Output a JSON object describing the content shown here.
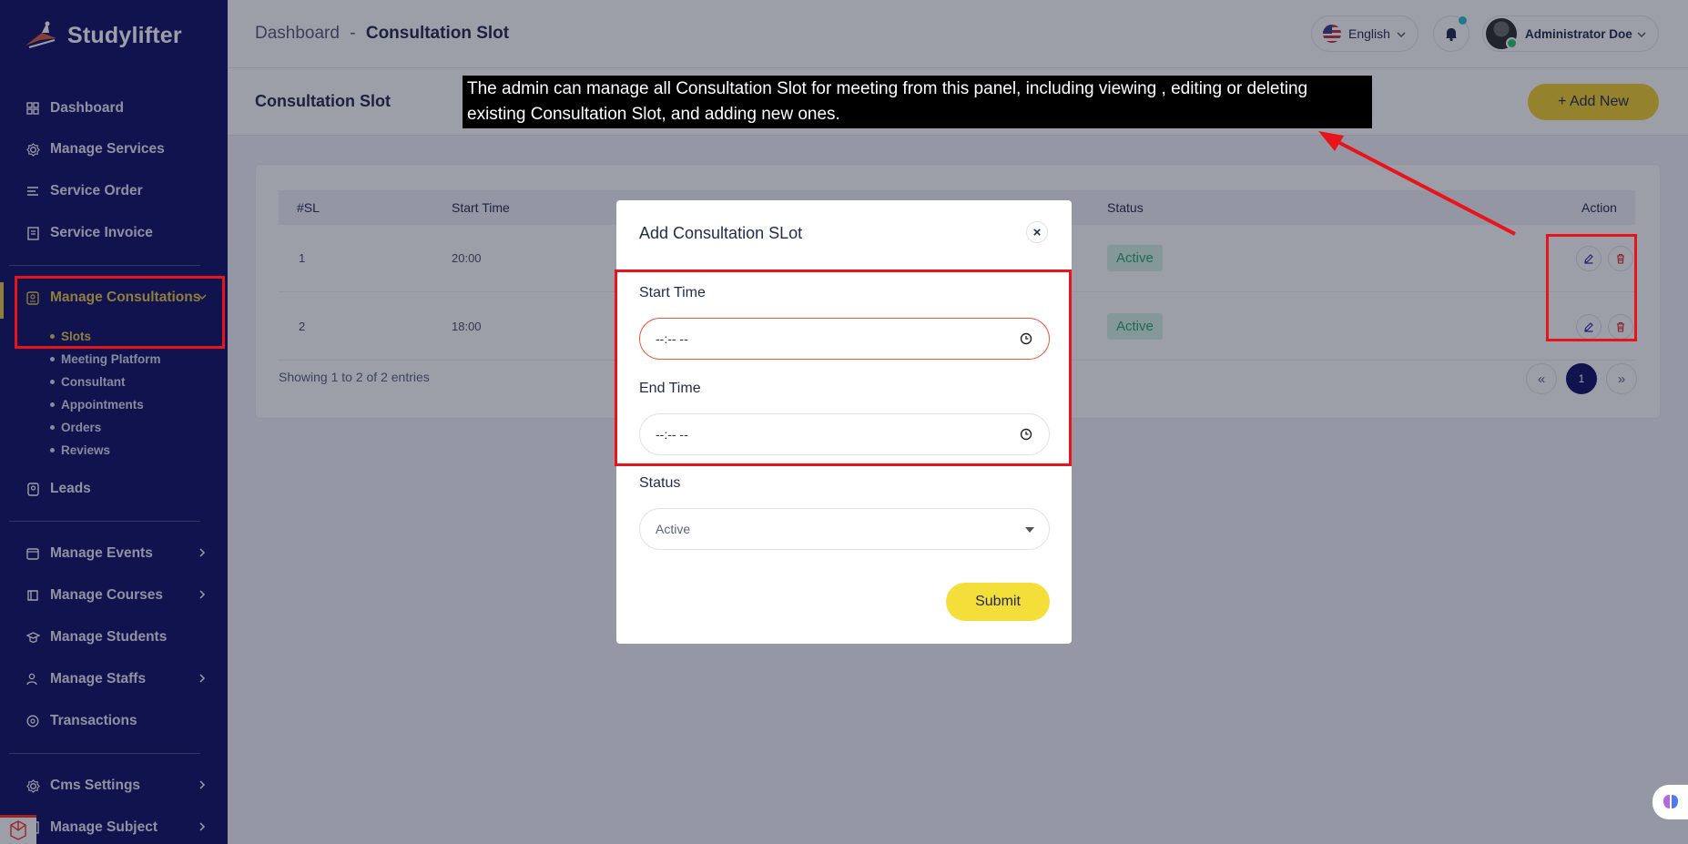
{
  "app": {
    "name": "Studylifter"
  },
  "sidebar": {
    "items": [
      {
        "label": "Dashboard",
        "icon": "grid-icon"
      },
      {
        "label": "Manage Services",
        "icon": "settings-icon"
      },
      {
        "label": "Service Order",
        "icon": "list-icon"
      },
      {
        "label": "Service Invoice",
        "icon": "invoice-icon"
      },
      {
        "label": "Manage Consultations",
        "icon": "consult-icon"
      },
      {
        "label": "Leads",
        "icon": "leads-icon"
      },
      {
        "label": "Manage Events",
        "icon": "calendar-icon"
      },
      {
        "label": "Manage Courses",
        "icon": "courses-icon"
      },
      {
        "label": "Manage Students",
        "icon": "students-icon"
      },
      {
        "label": "Manage Staffs",
        "icon": "staff-icon"
      },
      {
        "label": "Transactions",
        "icon": "transactions-icon"
      },
      {
        "label": "Cms Settings",
        "icon": "cms-icon"
      },
      {
        "label": "Manage Subject",
        "icon": "subject-icon"
      }
    ],
    "sub_items": [
      "Slots",
      "Meeting Platform",
      "Consultant",
      "Appointments",
      "Orders",
      "Reviews"
    ]
  },
  "header": {
    "breadcrumb_root": "Dashboard",
    "breadcrumb_sep": "-",
    "breadcrumb_current": "Consultation Slot",
    "language": "English",
    "user_name": "Administrator Doe"
  },
  "page": {
    "title": "Consultation Slot",
    "add_new_label": "+ Add New"
  },
  "table": {
    "columns": [
      "#SL",
      "Start Time",
      "Status",
      "Action"
    ],
    "rows": [
      {
        "sl": "1",
        "start": "20:00",
        "status": "Active"
      },
      {
        "sl": "2",
        "start": "18:00",
        "status": "Active"
      }
    ],
    "showing": "Showing 1 to 2 of 2 entries",
    "pagination": {
      "prev": "«",
      "current": "1",
      "next": "»"
    }
  },
  "modal": {
    "title": "Add Consultation SLot",
    "close": "×",
    "start_label": "Start Time",
    "start_value": "--:-- --",
    "end_label": "End Time",
    "end_value": "--:-- --",
    "status_label": "Status",
    "status_value": "Active",
    "submit_label": "Submit"
  },
  "annotation": {
    "text": "The admin can manage all Consultation Slot for meeting from this panel, including viewing , editing or deleting existing Consultation Slot, and adding new ones."
  },
  "colors": {
    "sidebar": "#0f1062",
    "accent": "#e6c64a",
    "highlight": "#e8141c",
    "button": "#f3cf2c"
  }
}
